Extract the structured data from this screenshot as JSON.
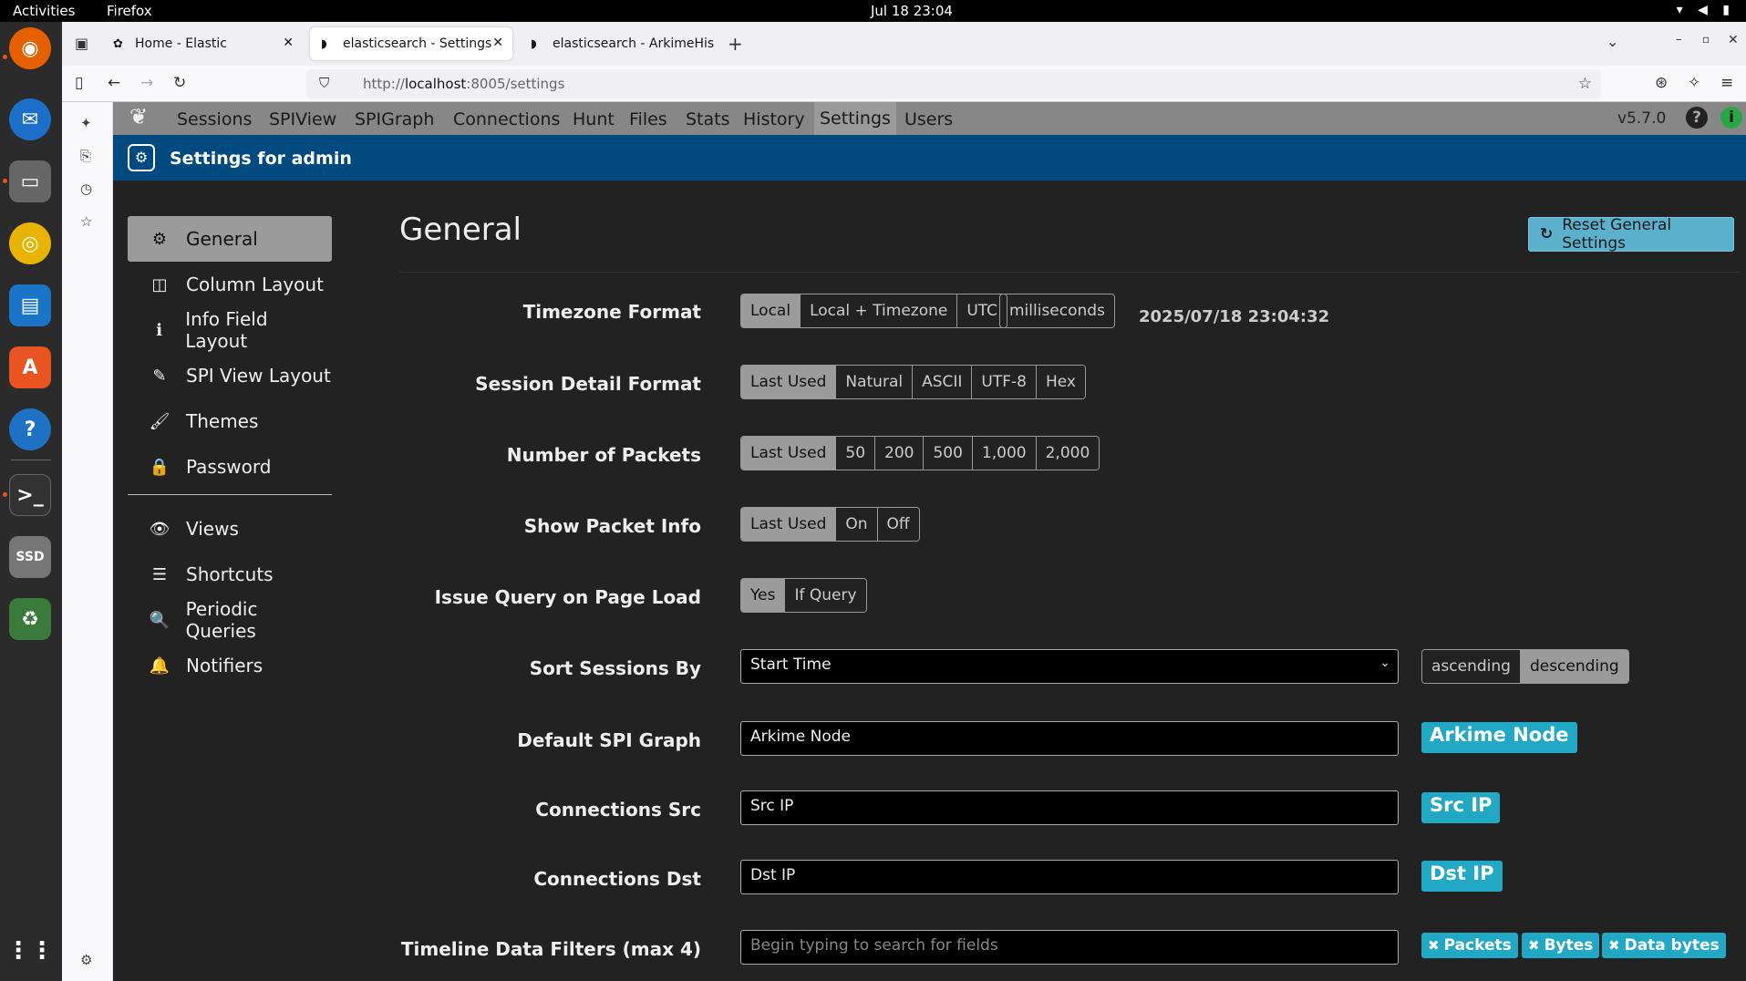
{
  "gnome": {
    "activities": "Activities",
    "app_name": "Firefox",
    "clock": "Jul 18  23:04"
  },
  "browser": {
    "tabs": [
      {
        "label": "Home - Elastic",
        "active": false
      },
      {
        "label": "elasticsearch - Settings",
        "active": true
      },
      {
        "label": "elasticsearch - ArkimeHis",
        "active": false
      }
    ],
    "url_prefix": "http://",
    "url_host": "localhost",
    "url_rest": ":8005/settings"
  },
  "app_nav": {
    "items": [
      "Sessions",
      "SPIView",
      "SPIGraph",
      "Connections",
      "Hunt",
      "Files",
      "Stats",
      "History",
      "Settings",
      "Users"
    ],
    "active": "Settings",
    "version": "v5.7.0"
  },
  "header": {
    "title": "Settings for admin"
  },
  "settings_nav": {
    "group1": [
      {
        "label": "General",
        "icon": "gear-icon",
        "active": true
      },
      {
        "label": "Column Layout",
        "icon": "columns-icon"
      },
      {
        "label": "Info Field Layout",
        "icon": "info-icon"
      },
      {
        "label": "SPI View Layout",
        "icon": "eyedropper-icon"
      },
      {
        "label": "Themes",
        "icon": "paintbrush-icon"
      },
      {
        "label": "Password",
        "icon": "lock-icon"
      }
    ],
    "group2": [
      {
        "label": "Views",
        "icon": "eye-icon"
      },
      {
        "label": "Shortcuts",
        "icon": "list-icon"
      },
      {
        "label": "Periodic Queries",
        "icon": "search-icon"
      },
      {
        "label": "Notifiers",
        "icon": "bell-icon"
      }
    ]
  },
  "general": {
    "title": "General",
    "reset_label": "Reset General Settings",
    "timezone": {
      "label": "Timezone Format",
      "options": [
        "Local",
        "Local + Timezone",
        "UTC"
      ],
      "selected": "Local",
      "extra": "milliseconds",
      "preview": "2025/07/18 23:04:32"
    },
    "session_detail": {
      "label": "Session Detail Format",
      "options": [
        "Last Used",
        "Natural",
        "ASCII",
        "UTF-8",
        "Hex"
      ],
      "selected": "Last Used"
    },
    "packets": {
      "label": "Number of Packets",
      "options": [
        "Last Used",
        "50",
        "200",
        "500",
        "1,000",
        "2,000"
      ],
      "selected": "Last Used"
    },
    "packet_info": {
      "label": "Show Packet Info",
      "options": [
        "Last Used",
        "On",
        "Off"
      ],
      "selected": "Last Used"
    },
    "issue_query": {
      "label": "Issue Query on Page Load",
      "options": [
        "Yes",
        "If Query"
      ],
      "selected": "Yes"
    },
    "sort_sessions": {
      "label": "Sort Sessions By",
      "value": "Start Time",
      "order_options": [
        "ascending",
        "descending"
      ],
      "order_selected": "descending"
    },
    "spi_graph": {
      "label": "Default SPI Graph",
      "value": "Arkime Node",
      "badge": "Arkime Node"
    },
    "conn_src": {
      "label": "Connections Src",
      "value": "Src IP",
      "badge": "Src IP"
    },
    "conn_dst": {
      "label": "Connections Dst",
      "value": "Dst IP",
      "badge": "Dst IP"
    },
    "timeline": {
      "label": "Timeline Data Filters (max 4)",
      "placeholder": "Begin typing to search for fields",
      "badges": [
        "Packets",
        "Bytes",
        "Data bytes"
      ]
    }
  },
  "colors": {
    "header_blue": "#004a80",
    "accent_teal": "#20a8c4",
    "nav_gray": "#878787",
    "selected_gray": "#9b9b9b"
  }
}
